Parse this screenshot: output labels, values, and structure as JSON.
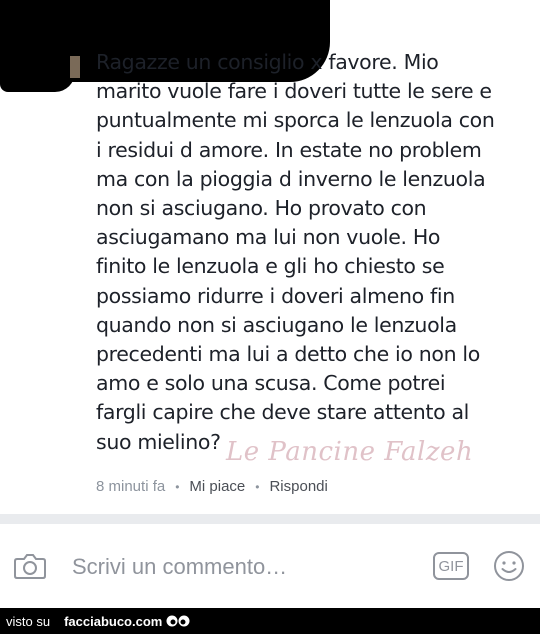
{
  "comment": {
    "text": "Ragazze un consiglio x favore. Mio\nmarito vuole fare i doveri tutte le sere e\npuntualmente mi sporca le lenzuola con\ni residui d amore. In estate no problem\nma con la pioggia d inverno le lenzuola\nnon si asciugano. Ho provato con\nasciugamano ma lui  non vuole.  Ho\nfinito le lenzuola e gli ho chiesto se\npossiamo ridurre i doveri almeno fin\nquando non si asciugano le lenzuola\nprecedenti ma lui a detto che io non lo\namo e solo una scusa. Come potrei\nfargli capire che deve stare attento al\nsuo mielino?",
    "watermark": "Le Pancine Falzeh",
    "time": "8 minuti fa",
    "like_label": "Mi piace",
    "reply_label": "Rispondi",
    "separator": "•"
  },
  "composer": {
    "placeholder": "Scrivi un commento…",
    "gif_label": "GIF",
    "icons": {
      "camera": "camera-icon",
      "emoji": "smiley-icon"
    }
  },
  "footer": {
    "visto_label": "visto su",
    "brand": "facciabuco.com"
  },
  "colors": {
    "text": "#1d2129",
    "meta": "#8d949e",
    "divider": "#e9ebee",
    "watermark": "#d9b3bb"
  }
}
